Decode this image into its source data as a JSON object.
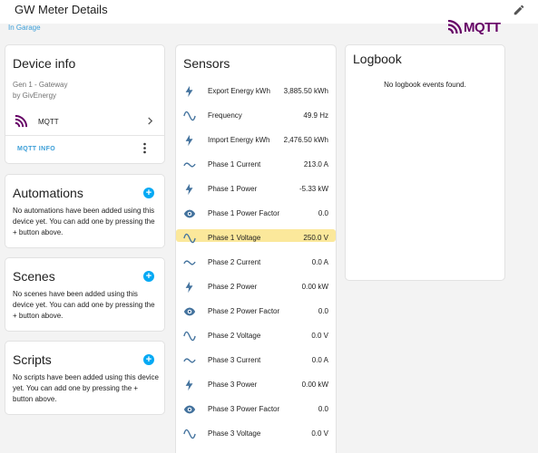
{
  "header": {
    "title": "GW Meter Details"
  },
  "area": "In Garage",
  "brand": {
    "name": "MQTT"
  },
  "device_info": {
    "title": "Device info",
    "model": "Gen 1 - Gateway",
    "manufacturer": "by GivEnergy",
    "integration": "MQTT",
    "info_link": "MQTT INFO"
  },
  "automations": {
    "title": "Automations",
    "empty_text": "No automations have been added using this device yet. You can add one by pressing the + button above."
  },
  "scenes": {
    "title": "Scenes",
    "empty_text": "No scenes have been added using this device yet. You can add one by pressing the + button above."
  },
  "scripts": {
    "title": "Scripts",
    "empty_text": "No scripts have been added using this device yet. You can add one by pressing the + button above."
  },
  "sensors": {
    "title": "Sensors",
    "items": [
      {
        "name": "Export Energy kWh",
        "value": "3,885.50 kWh",
        "icon": "flash-icon"
      },
      {
        "name": "Frequency",
        "value": "49.9 Hz",
        "icon": "sine-wave-icon"
      },
      {
        "name": "Import Energy kWh",
        "value": "2,476.50 kWh",
        "icon": "flash-icon"
      },
      {
        "name": "Phase 1 Current",
        "value": "213.0 A",
        "icon": "current-ac-icon"
      },
      {
        "name": "Phase 1 Power",
        "value": "-5.33 kW",
        "icon": "flash-icon"
      },
      {
        "name": "Phase 1 Power Factor",
        "value": "0.0",
        "icon": "eye-icon"
      },
      {
        "name": "Phase 1 Voltage",
        "value": "250.0 V",
        "icon": "sine-wave-icon"
      },
      {
        "name": "Phase 2 Current",
        "value": "0.0 A",
        "icon": "current-ac-icon"
      },
      {
        "name": "Phase 2 Power",
        "value": "0.00 kW",
        "icon": "flash-icon"
      },
      {
        "name": "Phase 2 Power Factor",
        "value": "0.0",
        "icon": "eye-icon"
      },
      {
        "name": "Phase 2 Voltage",
        "value": "0.0 V",
        "icon": "sine-wave-icon"
      },
      {
        "name": "Phase 3 Current",
        "value": "0.0 A",
        "icon": "current-ac-icon"
      },
      {
        "name": "Phase 3 Power",
        "value": "0.00 kW",
        "icon": "flash-icon"
      },
      {
        "name": "Phase 3 Power Factor",
        "value": "0.0",
        "icon": "eye-icon"
      },
      {
        "name": "Phase 3 Voltage",
        "value": "0.0 V",
        "icon": "sine-wave-icon"
      }
    ]
  },
  "logbook": {
    "title": "Logbook",
    "empty_text": "No logbook events found."
  },
  "colors": {
    "accent": "#03a9f4",
    "icon": "#44739e",
    "brand": "#660066",
    "highlight": "#fbe89b"
  }
}
